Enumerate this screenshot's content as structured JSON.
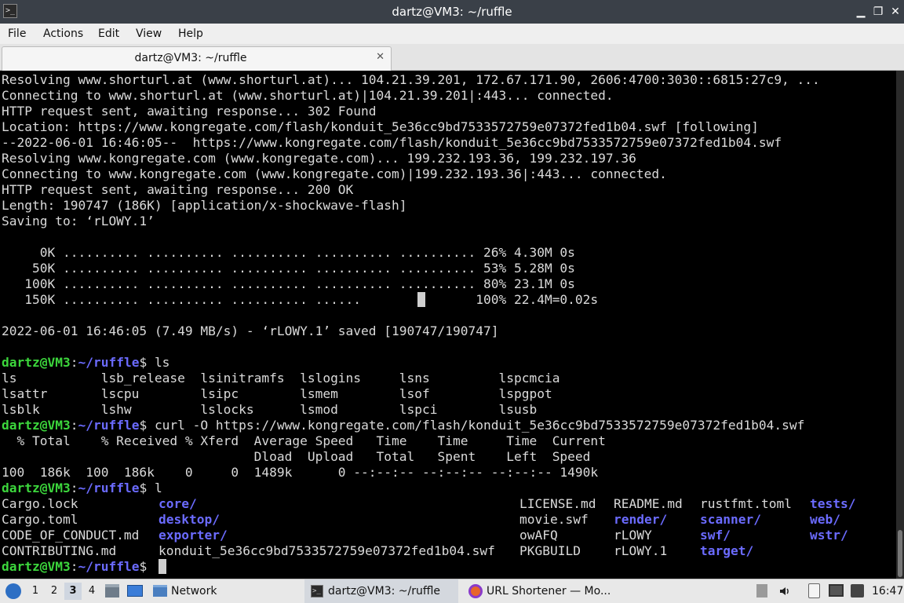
{
  "window": {
    "title": "dartz@VM3: ~/ruffle",
    "minimize": "▁",
    "restore": "❐",
    "close": "✕"
  },
  "menu": [
    "File",
    "Actions",
    "Edit",
    "View",
    "Help"
  ],
  "tab": {
    "label": "dartz@VM3: ~/ruffle",
    "close": "✕"
  },
  "terminal": {
    "wget": [
      "Resolving www.shorturl.at (www.shorturl.at)... 104.21.39.201, 172.67.171.90, 2606:4700:3030::6815:27c9, ...",
      "Connecting to www.shorturl.at (www.shorturl.at)|104.21.39.201|:443... connected.",
      "HTTP request sent, awaiting response... 302 Found",
      "Location: https://www.kongregate.com/flash/konduit_5e36cc9bd7533572759e07372fed1b04.swf [following]",
      "--2022-06-01 16:46:05--  https://www.kongregate.com/flash/konduit_5e36cc9bd7533572759e07372fed1b04.swf",
      "Resolving www.kongregate.com (www.kongregate.com)... 199.232.193.36, 199.232.197.36",
      "Connecting to www.kongregate.com (www.kongregate.com)|199.232.193.36|:443... connected.",
      "HTTP request sent, awaiting response... 200 OK",
      "Length: 190747 (186K) [application/x-shockwave-flash]",
      "Saving to: ‘rLOWY.1’"
    ],
    "progress": [
      "     0K .......... .......... .......... .......... .......... 26% 4.30M 0s",
      "    50K .......... .......... .......... .......... .......... 53% 5.28M 0s",
      "   100K .......... .......... .......... .......... .......... 80% 23.1M 0s",
      "   150K .......... .......... .......... ......               100% 22.4M=0.02s"
    ],
    "saved": "2022-06-01 16:46:05 (7.49 MB/s) - ‘rLOWY.1’ saved [190747/190747]",
    "prompt_user": "dartz@VM3",
    "prompt_sep": ":",
    "prompt_path": "~/ruffle",
    "prompt_end": "$ ",
    "cmd_ls": "ls",
    "ls_out": [
      "ls           lsb_release  lsinitramfs  lslogins     lsns         lspcmcia",
      "lsattr       lscpu        lsipc        lsmem        lsof         lspgpot",
      "lsblk        lshw         lslocks      lsmod        lspci        lsusb"
    ],
    "cmd_curl": "curl -O https://www.kongregate.com/flash/konduit_5e36cc9bd7533572759e07372fed1b04.swf",
    "curl_out": [
      "  % Total    % Received % Xferd  Average Speed   Time    Time     Time  Current",
      "                                 Dload  Upload   Total   Spent    Left  Speed",
      "100  186k  100  186k    0     0  1489k      0 --:--:-- --:--:-- --:--:-- 1490k"
    ],
    "cmd_l": "l",
    "listing": {
      "c1": [
        "Cargo.lock",
        "Cargo.toml",
        "CODE_OF_CONDUCT.md",
        "CONTRIBUTING.md"
      ],
      "c2": [
        "core/",
        "desktop/",
        "exporter/",
        "konduit_5e36cc9bd7533572759e07372fed1b04.swf"
      ],
      "c3": [
        "LICENSE.md",
        "movie.swf",
        "owAFQ",
        "PKGBUILD"
      ],
      "c4": [
        "README.md",
        "render/",
        "rLOWY",
        "rLOWY.1"
      ],
      "c5": [
        "rustfmt.toml",
        "scanner/",
        "swf/",
        "target/"
      ],
      "c6": [
        "tests/",
        "web/",
        "wstr/",
        ""
      ]
    }
  },
  "taskbar": {
    "workspaces": [
      "1",
      "2",
      "3",
      "4"
    ],
    "active_workspace": "3",
    "network_label": "Network",
    "task_terminal": "dartz@VM3: ~/ruffle",
    "task_firefox": "URL Shortener — Mo...",
    "clock": "16:47",
    "icons": [
      "menu-icon",
      "file-manager-icon",
      "desktop-icon",
      "folder-icon",
      "terminal-icon",
      "firefox-icon",
      "eject-icon",
      "volume-icon",
      "clipboard-icon",
      "monitor-icon",
      "notification-icon"
    ]
  },
  "colors": {
    "prompt_green": "#3cd63c",
    "dir_blue": "#6b6bff",
    "terminal_bg": "#000000",
    "titlebar": "#3a4048"
  }
}
